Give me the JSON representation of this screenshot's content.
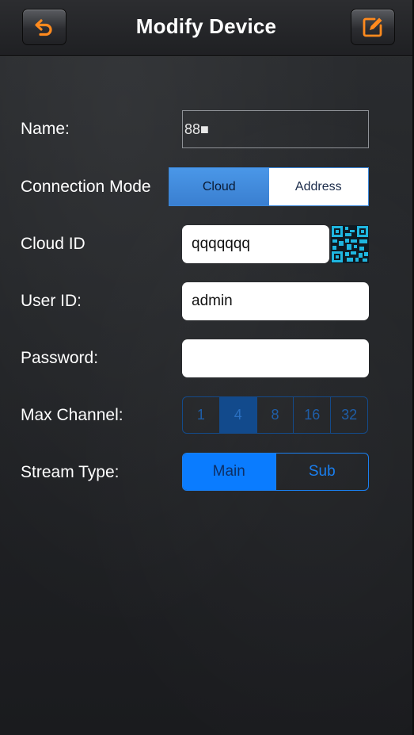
{
  "header": {
    "title": "Modify Device",
    "back_icon": "undo-arrow-icon",
    "edit_icon": "edit-pencil-icon",
    "accent": "#ff8a1e"
  },
  "form": {
    "name_label": "Name:",
    "name_value": "88■",
    "connection_mode_label": "Connection Mode",
    "connection_modes": [
      "Cloud",
      "Address"
    ],
    "connection_mode_selected": "Cloud",
    "cloud_id_label": "Cloud ID",
    "cloud_id_value": "qqqqqqq",
    "qr_icon": "qr-code-icon",
    "user_id_label": "User ID:",
    "user_id_value": "admin",
    "password_label": "Password:",
    "password_value": "",
    "max_channel_label": "Max Channel:",
    "max_channel_options": [
      "1",
      "4",
      "8",
      "16",
      "32"
    ],
    "max_channel_selected": "4",
    "stream_type_label": "Stream Type:",
    "stream_type_options": [
      "Main",
      "Sub"
    ],
    "stream_type_selected": "Main"
  },
  "colors": {
    "selected_blue": "#0a7cff",
    "mode_blue": "#4a97e8",
    "channel_blue": "#124a8c",
    "qr_cyan": "#1fb6e0"
  }
}
